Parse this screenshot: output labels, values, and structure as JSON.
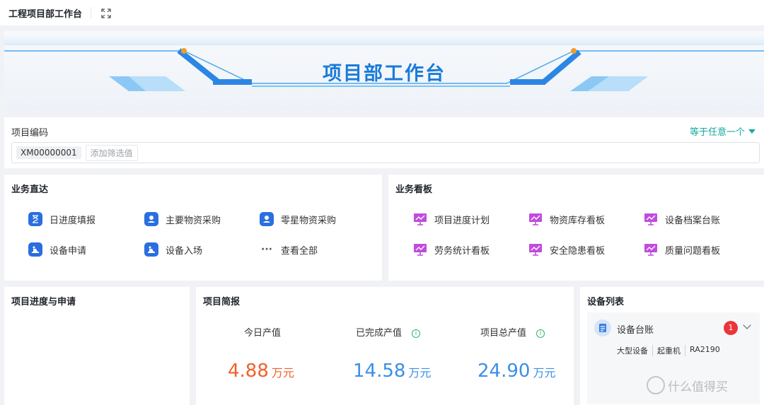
{
  "topbar": {
    "title": "工程项目部工作台"
  },
  "banner": {
    "title": "项目部工作台"
  },
  "filter": {
    "label": "项目编码",
    "operator": "等于任意一个",
    "tag": "XM00000001",
    "add_placeholder": "添加筛选值"
  },
  "business": {
    "title": "业务直达",
    "items": [
      {
        "label": "日进度填报",
        "icon": "hourglass-icon"
      },
      {
        "label": "主要物资采购",
        "icon": "purchase-icon"
      },
      {
        "label": "零星物资采购",
        "icon": "purchase-icon"
      },
      {
        "label": "设备申请",
        "icon": "equipment-icon"
      },
      {
        "label": "设备入场",
        "icon": "equipment-icon"
      },
      {
        "label": "查看全部",
        "icon": "more-icon"
      }
    ]
  },
  "board": {
    "title": "业务看板",
    "items": [
      {
        "label": "项目进度计划"
      },
      {
        "label": "物资库存看板"
      },
      {
        "label": "设备档案台账"
      },
      {
        "label": "劳务统计看板"
      },
      {
        "label": "安全隐患看板"
      },
      {
        "label": "质量问题看板"
      }
    ]
  },
  "progress": {
    "title": "项目进度与申请"
  },
  "brief": {
    "title": "项目简报",
    "metrics": [
      {
        "label": "今日产值",
        "value": "4.88",
        "unit": "万元",
        "color": "#f0612a"
      },
      {
        "label": "已完成产值",
        "value": "14.58",
        "unit": "万元",
        "color": "#3b8fe5"
      },
      {
        "label": "项目总产值",
        "value": "24.90",
        "unit": "万元",
        "color": "#3b8fe5"
      }
    ]
  },
  "equipment": {
    "title": "设备列表",
    "name": "设备台账",
    "badge": "1",
    "meta": [
      "大型设备",
      "起重机",
      "RA2190"
    ]
  },
  "watermark": "什么值得买",
  "colors": {
    "accent": "#13a89e",
    "blue": "#2a6ee0",
    "purple": "#c04cde",
    "red": "#e8363b"
  }
}
